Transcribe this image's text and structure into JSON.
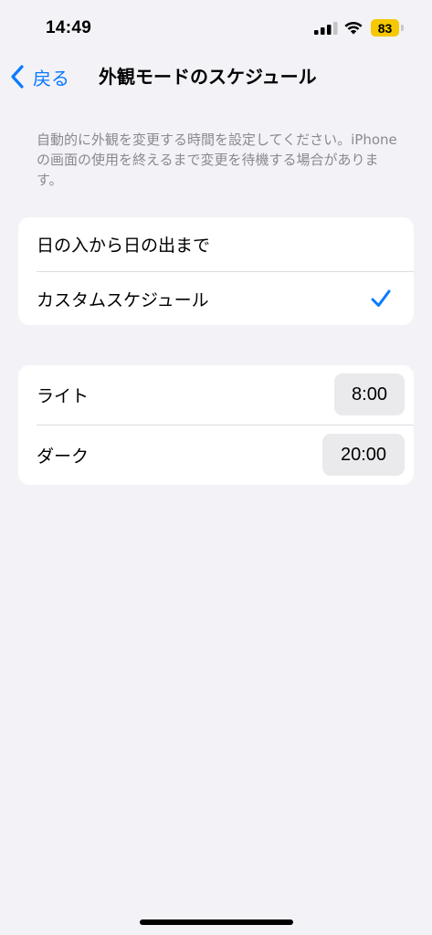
{
  "status_bar": {
    "time": "14:49",
    "battery_level": "83",
    "battery_color": "#f5c800"
  },
  "nav": {
    "back_label": "戻る",
    "title": "外観モードのスケジュール"
  },
  "description": "自動的に外観を変更する時間を設定してください。iPhoneの画面の使用を終えるまで変更を待機する場合があります。",
  "schedule_options": {
    "items": [
      {
        "label": "日の入から日の出まで",
        "selected": false
      },
      {
        "label": "カスタムスケジュール",
        "selected": true
      }
    ]
  },
  "custom_times": {
    "light_label": "ライト",
    "light_time": "8:00",
    "dark_label": "ダーク",
    "dark_time": "20:00"
  },
  "colors": {
    "accent": "#0a7aff",
    "background": "#f2f2f7"
  }
}
